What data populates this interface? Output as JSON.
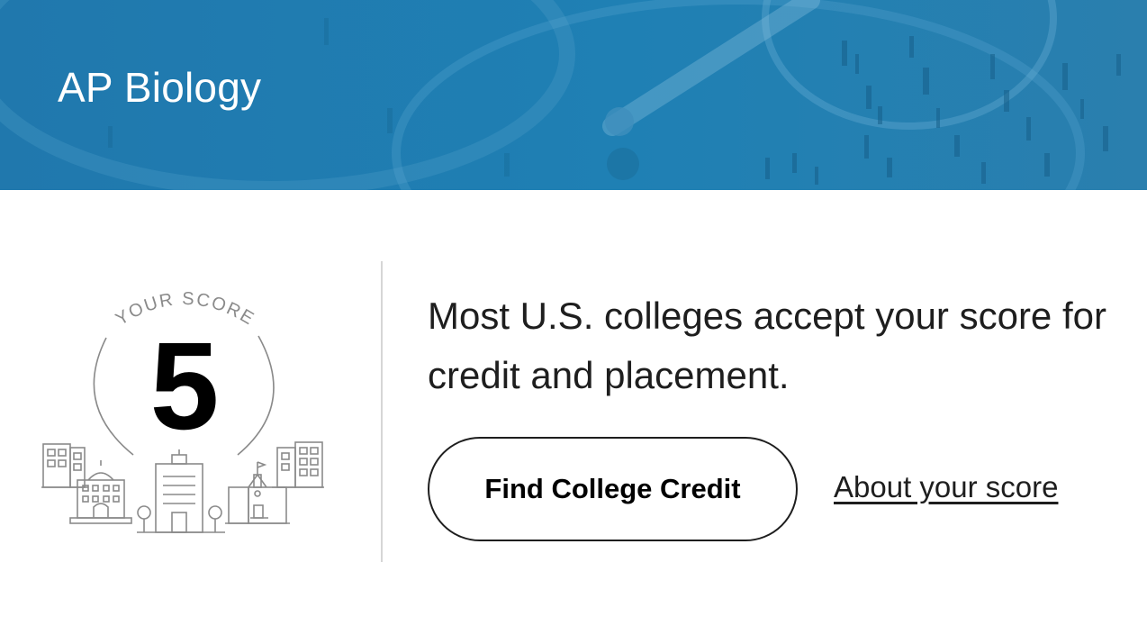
{
  "banner": {
    "title": "AP Biology"
  },
  "score": {
    "label": "YOUR SCORE",
    "value": "5"
  },
  "message": {
    "text": "Most U.S. colleges accept your score for credit and placement."
  },
  "actions": {
    "find_credit_label": "Find College Credit",
    "about_score_label": "About your score"
  },
  "colors": {
    "banner_blue": "#1f7fb2",
    "text": "#1e1e1e",
    "illustration_stroke": "#8a8a8a"
  }
}
